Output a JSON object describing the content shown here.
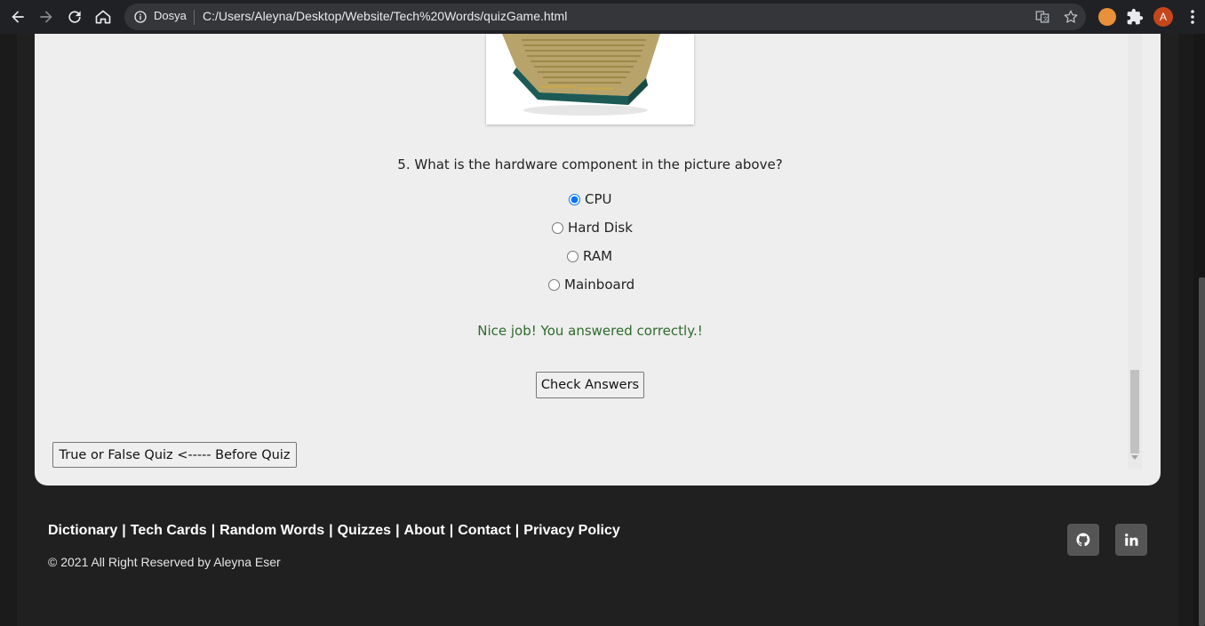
{
  "browser": {
    "site_name": "Dosya",
    "url": "C:/Users/Aleyna/Desktop/Website/Tech%20Words/quizGame.html",
    "avatar_letter": "A"
  },
  "quiz": {
    "question": "5. What is the hardware component in the picture above?",
    "options": [
      {
        "label": "CPU",
        "checked": true
      },
      {
        "label": "Hard Disk",
        "checked": false
      },
      {
        "label": "RAM",
        "checked": false
      },
      {
        "label": "Mainboard",
        "checked": false
      }
    ],
    "feedback": "Nice job! You answered correctly.!",
    "check_button": "Check Answers",
    "prev_button": "True or False Quiz <----- Before Quiz"
  },
  "footer": {
    "links": [
      "Dictionary",
      "Tech Cards",
      "Random Words",
      "Quizzes",
      "About",
      "Contact",
      "Privacy Policy"
    ],
    "separator": "|",
    "copyright": "© 2021 All Right Reserved by Aleyna Eser",
    "social": [
      "github-icon",
      "linkedin-icon"
    ]
  },
  "colors": {
    "feedback": "#2e6b2e",
    "card_bg": "#eeeeee",
    "page_bg": "#202020"
  }
}
